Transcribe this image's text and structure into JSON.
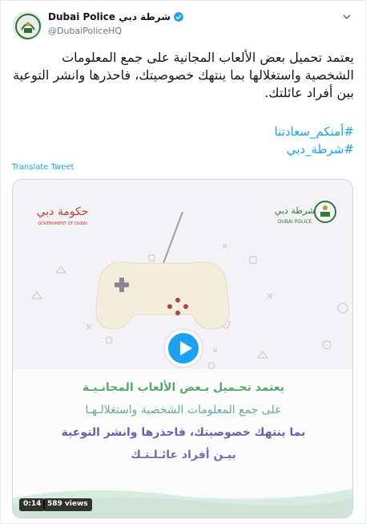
{
  "account": {
    "display_name": "Dubai Police شرطة دبي",
    "handle": "@DubaiPoliceHQ"
  },
  "tweet": {
    "text": "يعتمد تحميل بعض الألعاب المجانية على جمع المعلومات الشخصية واستغلالها بما ينتهك خصوصيتك، فاحذرها وانشر التوعية بين أفراد عائلتك.",
    "hashtags": [
      "#أمنكم_سعادتنا",
      "#شرطة_دبي"
    ],
    "translate_label": "Translate Tweet"
  },
  "video": {
    "logo_left_arabic": "حكومة دبي",
    "logo_left_english": "GOVERNMENT OF DUBAI",
    "logo_right_arabic": "شرطة دبي",
    "logo_right_english": "DUBAI POLICE",
    "lines": [
      "يعتمد تحـميل بـعض الألعاب المجانـيـة",
      "على جمع المعلومات الشخصية واستغلالـهـا",
      "بما ينتهك خصوصيتك، فاحذرها وانشر التوعية",
      "بيـن أفراد عائـلـتـك"
    ],
    "duration": "0:14",
    "views": "589 views"
  },
  "colors": {
    "accent": "#1da1f2",
    "green": "#59a96f",
    "purple": "#6b5fa8"
  },
  "icons": [
    "verified-badge-icon",
    "chevron-down-icon",
    "play-icon",
    "dpad-icon"
  ]
}
